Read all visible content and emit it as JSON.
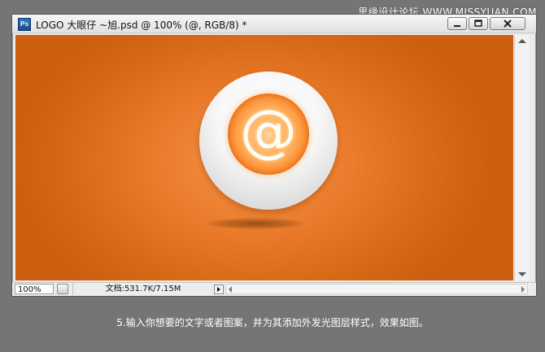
{
  "watermark": "思缘设计论坛 WWW.MISSYUAN.COM",
  "window": {
    "title": "LOGO 大眼仔 ~旭.psd @ 100% (@, RGB/8) *",
    "app_icon_label": "Ps",
    "app_icon": "photoshop-icon",
    "controls": {
      "minimize_icon": "minimize-icon",
      "maximize_icon": "maximize-icon",
      "close_icon": "close-icon"
    }
  },
  "canvas": {
    "glyph": "@",
    "background_color": "#e3721f",
    "ball_color": "#f4f4f4",
    "glow_color": "#ff8a2a"
  },
  "status_bar": {
    "zoom": "100%",
    "doc_info": "文档:531.7K/7.15M"
  },
  "caption": "5.输入你想要的文字或者图案，并为其添加外发光图层样式，效果如图。"
}
